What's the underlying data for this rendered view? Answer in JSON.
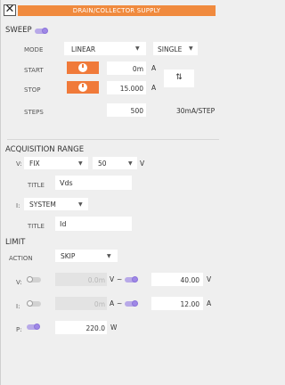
{
  "header": {
    "close_icon": "close-icon",
    "title": "DRAIN/COLLECTOR SUPPLY"
  },
  "sweep": {
    "heading": "SWEEP",
    "mode_label": "MODE",
    "mode_value": "LINEAR",
    "repeat_value": "SINGLE",
    "start_label": "START",
    "start_value": "0m",
    "start_unit": "A",
    "stop_label": "STOP",
    "stop_value": "15.000",
    "stop_unit": "A",
    "swap_symbol": "⇅",
    "steps_label": "STEPS",
    "steps_value": "500",
    "step_size": "30mA/STEP"
  },
  "acquisition": {
    "heading": "ACQUISITION RANGE",
    "v_label": "V:",
    "v_mode": "FIX",
    "v_range": "50",
    "v_unit": "V",
    "v_title_label": "TITLE",
    "v_title": "Vds",
    "i_label": "I:",
    "i_mode": "SYSTEM",
    "i_title_label": "TITLE",
    "i_title": "Id"
  },
  "limit": {
    "heading": "LIMIT",
    "action_label": "ACTION",
    "action_value": "SKIP",
    "v_label": "V:",
    "v_low": "0.0m",
    "v_low_unit": "V",
    "v_tilde": "~",
    "v_high": "40.00",
    "v_high_unit": "V",
    "i_label": "I:",
    "i_low": "0m",
    "i_low_unit": "A",
    "i_tilde": "~",
    "i_high": "12.00",
    "i_high_unit": "A",
    "p_label": "P:",
    "p_value": "220.0",
    "p_unit": "W"
  },
  "colors": {
    "accent": "#f08a3e",
    "toggle": "#9f88e6"
  }
}
